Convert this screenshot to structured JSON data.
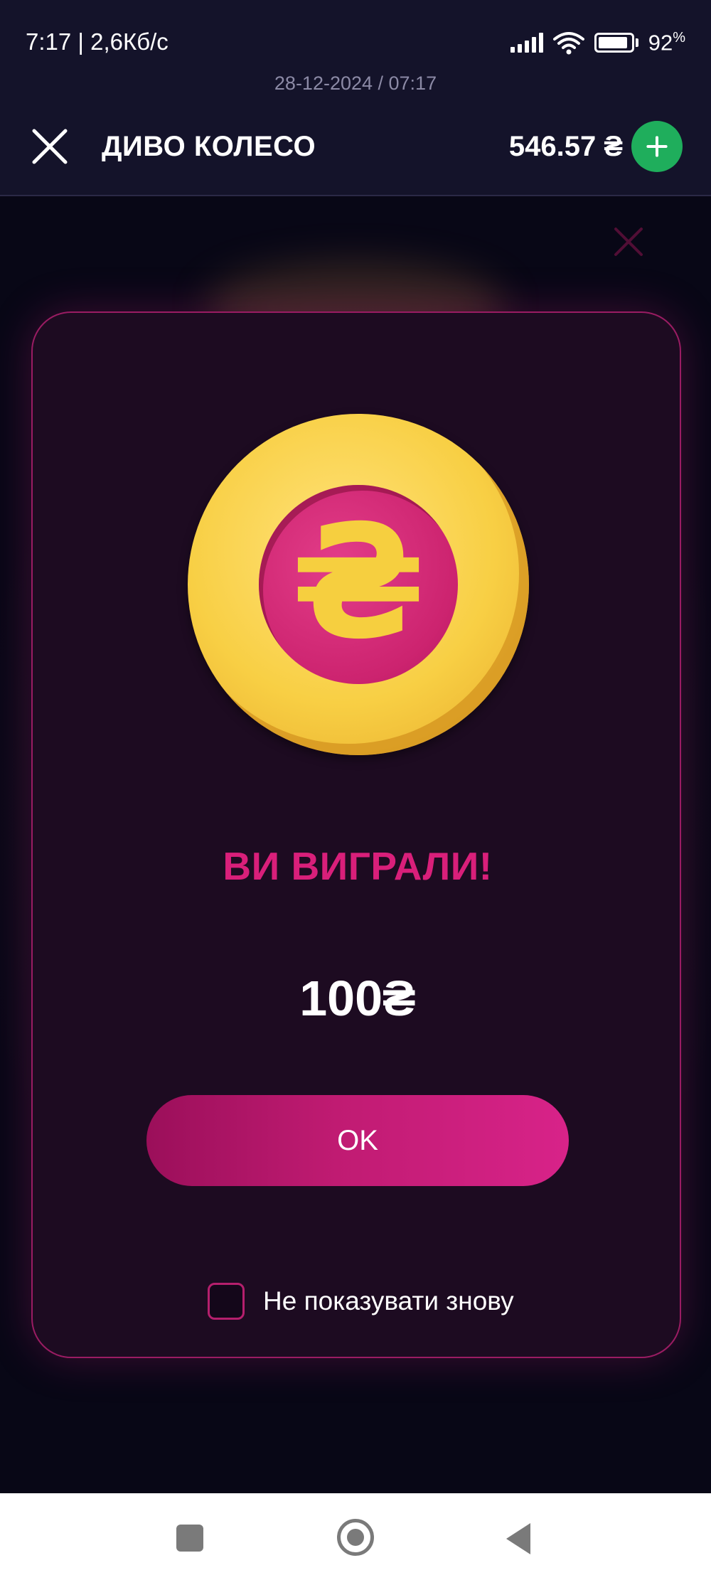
{
  "status_bar": {
    "time_speed": "7:17 | 2,6Кб/с",
    "battery_percent": "92",
    "battery_unit": "%",
    "battery_level": 0.92,
    "icons": [
      "signal-icon",
      "wifi-icon",
      "battery-icon"
    ]
  },
  "date_line": "28-12-2024 / 07:17",
  "header": {
    "title": "ДИВО КОЛЕСО",
    "balance": "546.57 ₴",
    "close_icon": "close-icon",
    "add_icon": "plus-icon",
    "add_button_color": "#1fae5c"
  },
  "modal": {
    "coin_symbol": "₴",
    "title": "ВИ ВИГРАЛИ!",
    "amount": "100₴",
    "ok_label": "OK",
    "checkbox_label": "Не показувати знову",
    "checkbox_checked": false,
    "accent_color": "#d91f7a",
    "coin_color": "#f8cf44"
  },
  "nav_bar": {
    "icons": [
      "recent-apps-icon",
      "home-icon",
      "back-icon"
    ]
  }
}
